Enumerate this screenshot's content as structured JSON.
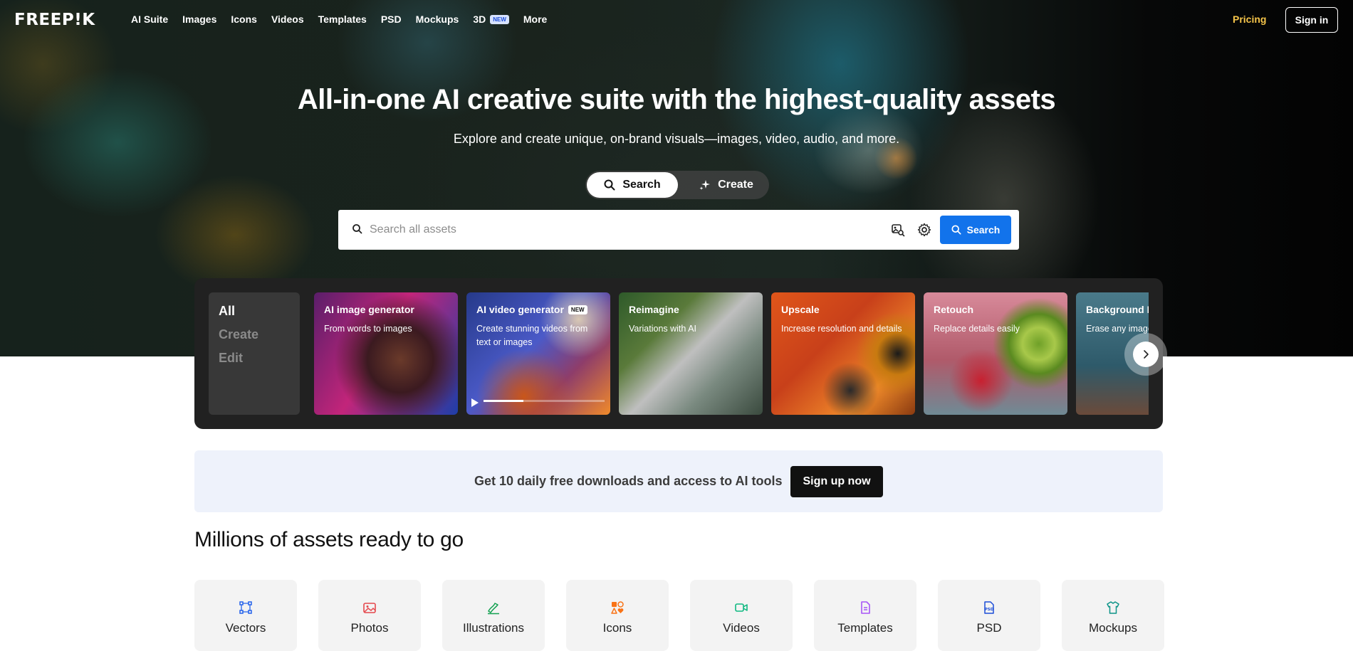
{
  "brand": {
    "logo": "FREEP!K"
  },
  "nav": {
    "links": [
      {
        "label": "AI Suite"
      },
      {
        "label": "Images"
      },
      {
        "label": "Icons"
      },
      {
        "label": "Videos"
      },
      {
        "label": "Templates"
      },
      {
        "label": "PSD"
      },
      {
        "label": "Mockups"
      },
      {
        "label": "3D",
        "badge": "NEW"
      },
      {
        "label": "More"
      }
    ],
    "pricing": "Pricing",
    "sign_in": "Sign in"
  },
  "hero": {
    "title": "All-in-one AI creative suite with the highest-quality assets",
    "subtitle": "Explore and create unique, on-brand visuals—images, video, audio, and more.",
    "mode_search": "Search",
    "mode_create": "Create",
    "search_placeholder": "Search all assets",
    "search_button": "Search"
  },
  "tools": {
    "categories": [
      "All",
      "Create",
      "Edit"
    ],
    "active_category": "All",
    "cards": [
      {
        "title": "AI image generator",
        "desc": "From words to images"
      },
      {
        "title": "AI video generator",
        "badge": "NEW",
        "desc": "Create stunning videos from text or images",
        "video_progress": 0.33
      },
      {
        "title": "Reimagine",
        "desc": "Variations with AI"
      },
      {
        "title": "Upscale",
        "desc": "Increase resolution and details"
      },
      {
        "title": "Retouch",
        "desc": "Replace details easily"
      },
      {
        "title": "Background Remover",
        "desc": "Erase any image background"
      }
    ]
  },
  "signup": {
    "text": "Get 10 daily free downloads and access to AI tools",
    "button": "Sign up now"
  },
  "assets": {
    "title": "Millions of assets ready to go",
    "items": [
      {
        "label": "Vectors",
        "icon": "vectors-icon",
        "color": "#2563eb"
      },
      {
        "label": "Photos",
        "icon": "photos-icon",
        "color": "#e5484d"
      },
      {
        "label": "Illustrations",
        "icon": "illustrations-icon",
        "color": "#12a150"
      },
      {
        "label": "Icons",
        "icon": "icons-icon",
        "color": "#f97316"
      },
      {
        "label": "Videos",
        "icon": "videos-icon",
        "color": "#10b981"
      },
      {
        "label": "Templates",
        "icon": "templates-icon",
        "color": "#a855f7"
      },
      {
        "label": "PSD",
        "icon": "psd-icon",
        "color": "#1d4ed8"
      },
      {
        "label": "Mockups",
        "icon": "mockups-icon",
        "color": "#0d9488"
      }
    ]
  }
}
